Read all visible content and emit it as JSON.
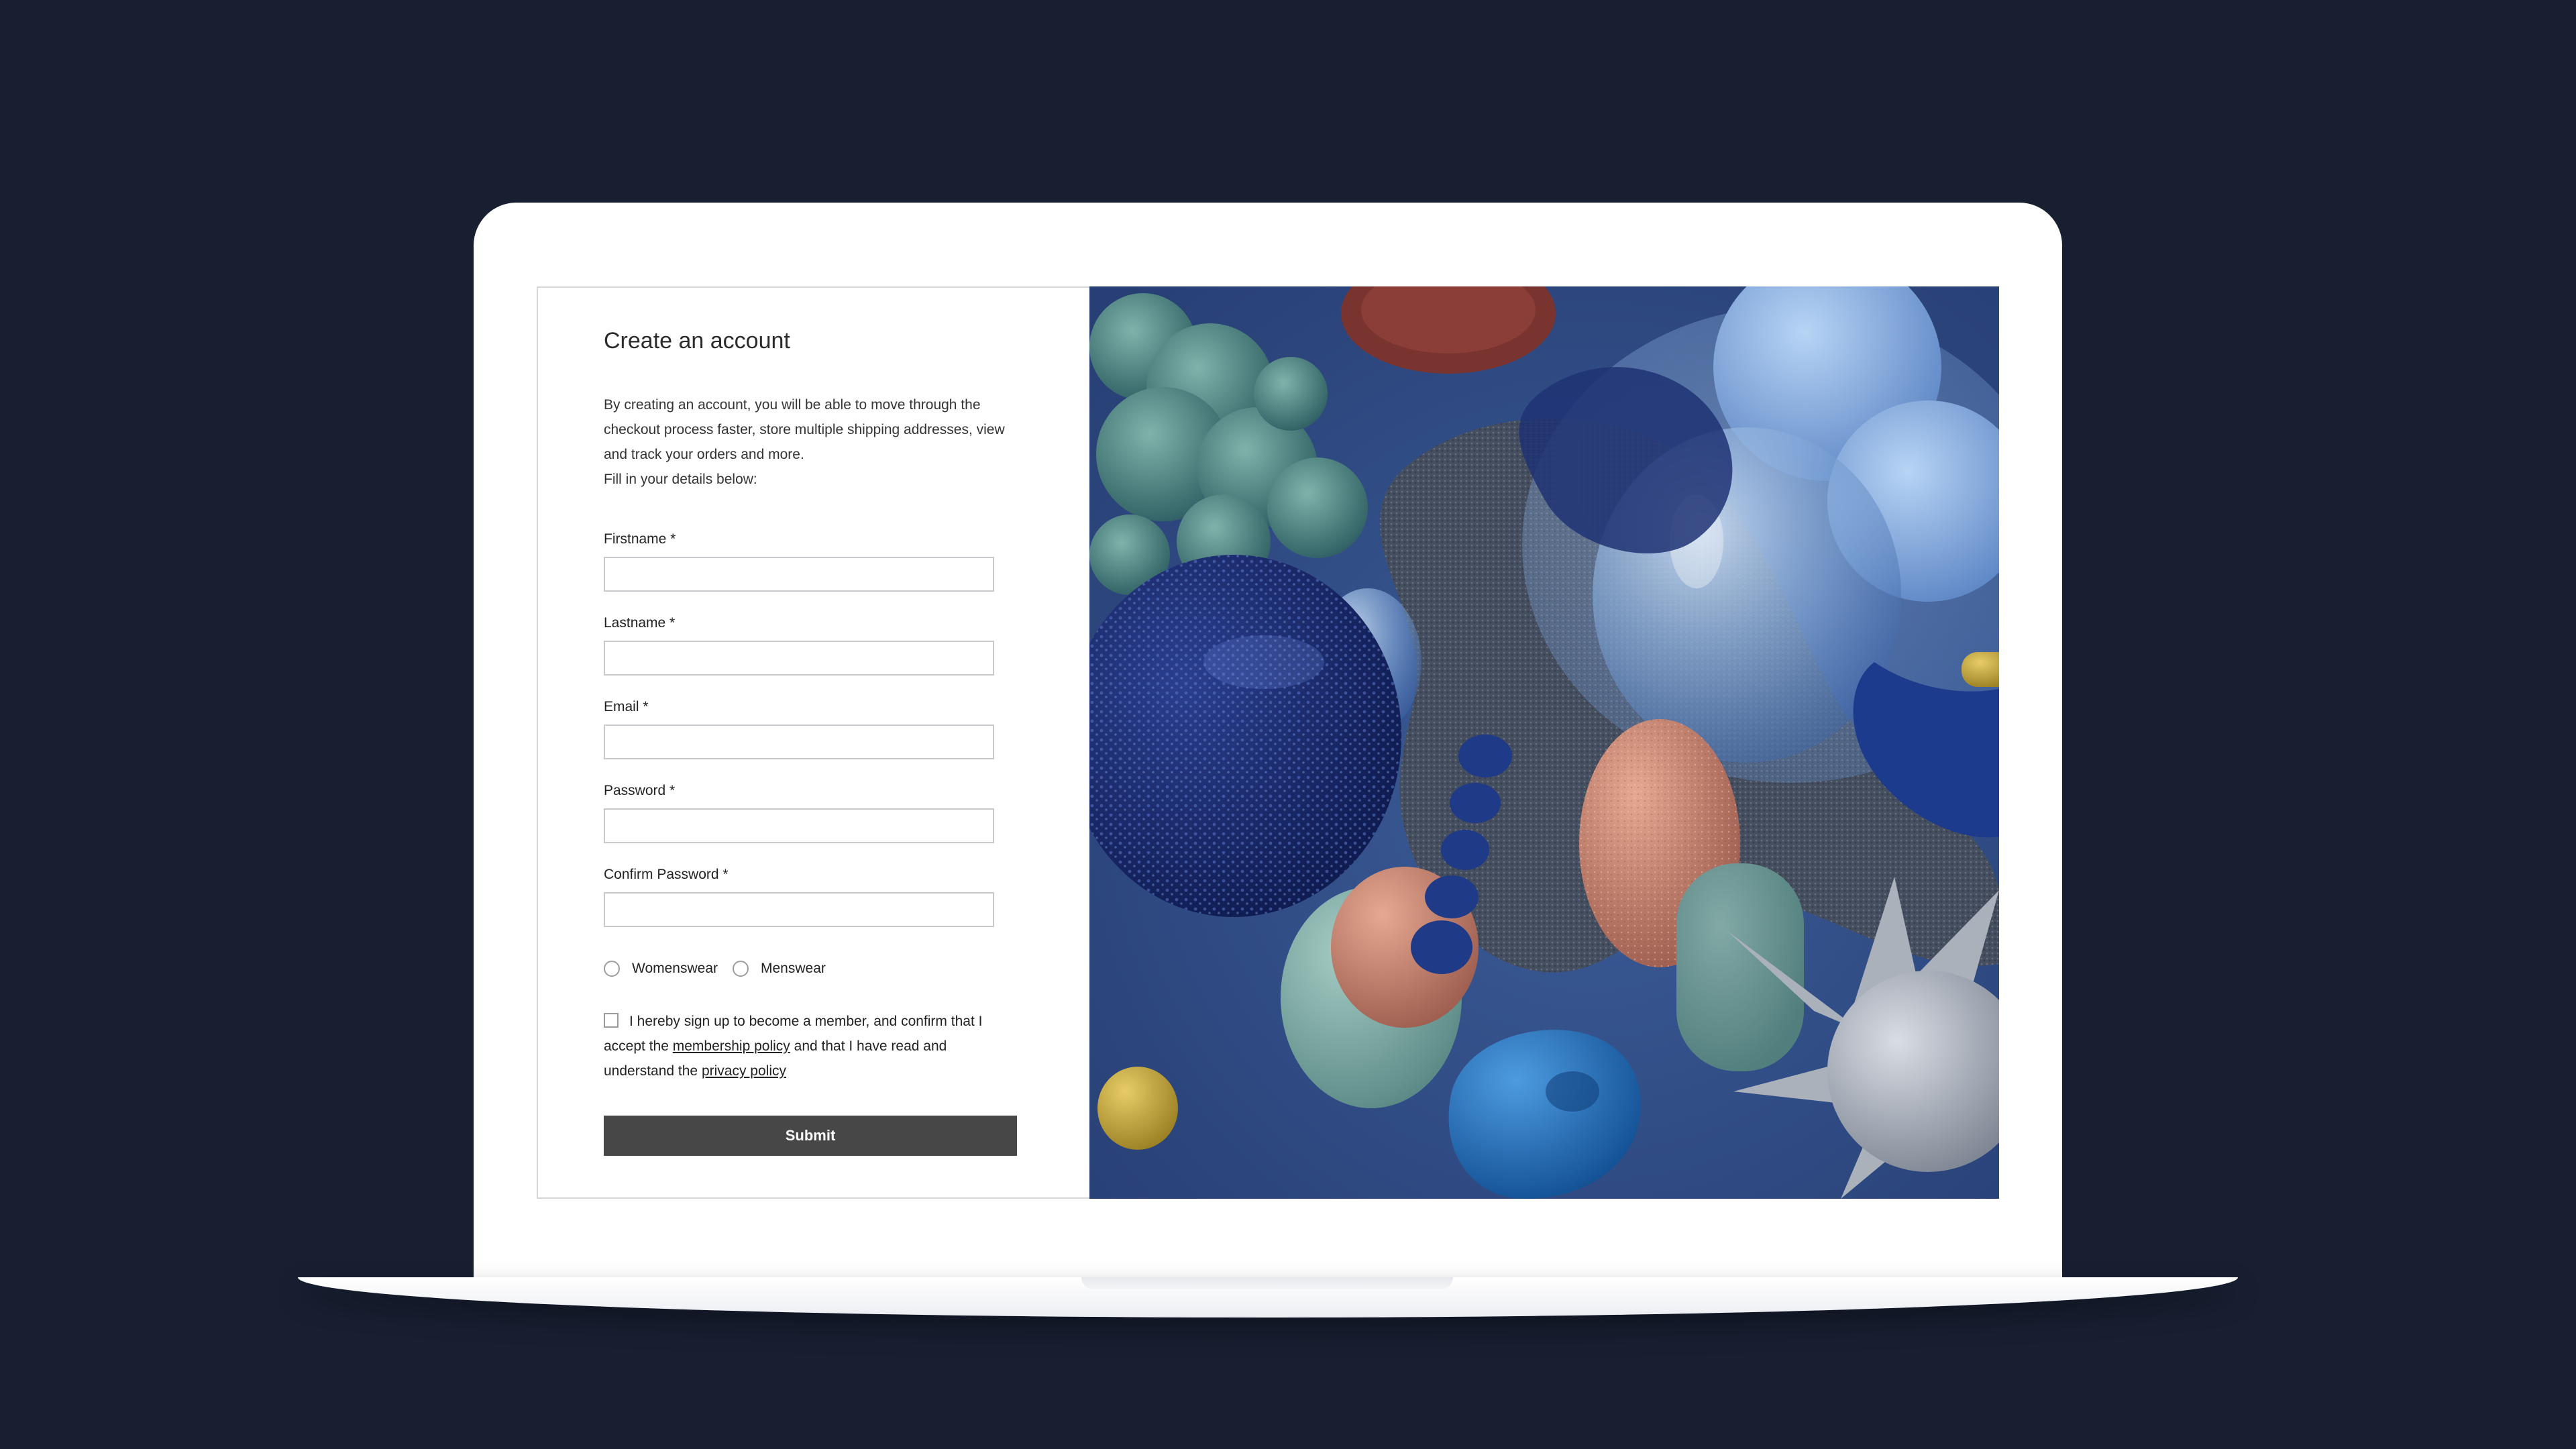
{
  "form": {
    "title": "Create an account",
    "intro": [
      "By creating an account, you will be able to move through the checkout process faster, store multiple shipping addresses, view and track your orders and more.",
      "Fill in your details below:"
    ],
    "fields": [
      {
        "label": "Firstname *",
        "value": ""
      },
      {
        "label": "Lastname *",
        "value": ""
      },
      {
        "label": "Email *",
        "value": ""
      },
      {
        "label": "Password *",
        "value": ""
      },
      {
        "label": "Confirm Password *",
        "value": ""
      }
    ],
    "gender_options": [
      "Womenswear",
      "Menswear"
    ],
    "consent": {
      "part1": "I hereby sign up to become a member, and confirm that I accept the ",
      "link1": "membership policy",
      "part2": " and that I have read and understand the ",
      "link2": "privacy policy",
      "checked": false
    },
    "submit_label": "Submit"
  },
  "colors": {
    "page_background": "#171f31",
    "button": "#474747",
    "hero_background": "#2f4c85"
  }
}
